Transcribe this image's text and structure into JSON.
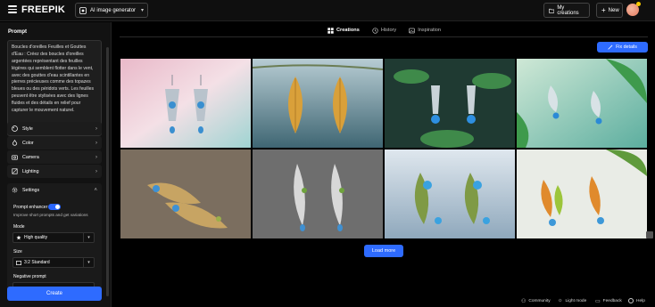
{
  "header": {
    "logo": "FREEPIK",
    "tool_selector": "AI image generator",
    "my_creations": "My creations",
    "new_label": "New"
  },
  "sidebar": {
    "prompt_title": "Prompt",
    "prompt_text": "Boucles d'oreilles Feuilles et Gouttes d'Eau : Créez des boucles d'oreilles argentées représentant des feuilles légères qui semblent flotter dans le vent, avec des gouttes d'eau scintillantes en pierres précieuses comme des topazes bleues ou des péridots verts. Les feuilles peuvent être stylisées avec des lignes fluides et des détails en relief pour capturer le mouvement naturel.",
    "sections": [
      {
        "label": "Style",
        "icon": "palette-icon"
      },
      {
        "label": "Color",
        "icon": "droplet-icon"
      },
      {
        "label": "Camera",
        "icon": "camera-icon"
      },
      {
        "label": "Lighting",
        "icon": "lighting-icon"
      }
    ],
    "settings": {
      "title": "Settings",
      "prompt_enhancer": "Prompt enhancer",
      "enhancer_hint": "Improve short prompts and get variations",
      "mode_label": "Mode",
      "mode_value": "High quality",
      "size_label": "Size",
      "size_value": "3:2 Standard",
      "negative_prompt": "Negative prompt"
    },
    "create_label": "Create"
  },
  "tabs": [
    {
      "label": "Creations",
      "active": true
    },
    {
      "label": "History",
      "active": false
    },
    {
      "label": "Inspiration",
      "active": false
    }
  ],
  "fix_details": "Fix details",
  "load_more": "Load more",
  "footer": {
    "community": "Community",
    "light_mode": "Light mode",
    "feedback": "Feedback",
    "help": "Help"
  },
  "colors": {
    "accent": "#2e6bff",
    "background": "#000000",
    "panel": "#121212"
  }
}
